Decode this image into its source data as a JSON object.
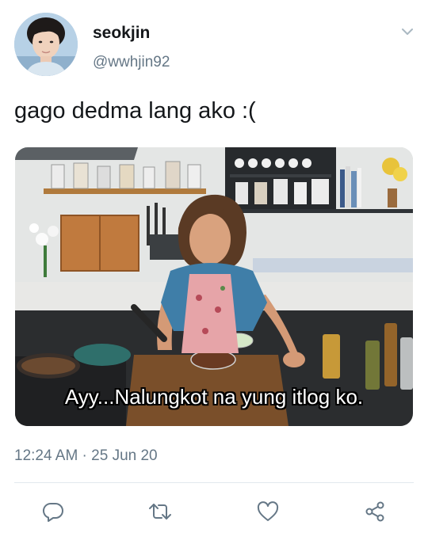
{
  "tweet": {
    "display_name": "seokjin",
    "handle": "@wwhjin92",
    "text": "gago dedma lang ako :(",
    "timestamp": "12:24 AM · 25 Jun 20",
    "media": {
      "subtitle": "Ayy...Nalungkot na yung itlog ko."
    }
  },
  "icons": {
    "more": "chevron-down-icon",
    "reply": "reply-icon",
    "retweet": "retweet-icon",
    "like": "like-icon",
    "share": "share-icon"
  },
  "colors": {
    "text_primary": "#14171a",
    "text_secondary": "#657786",
    "icon": "#657786",
    "divider": "#e1e8ed"
  }
}
